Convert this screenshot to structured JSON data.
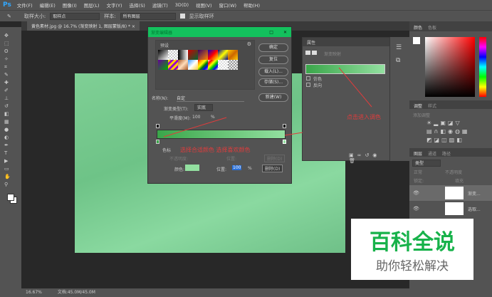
{
  "menubar": {
    "logo": "Ps",
    "items": [
      "文件(F)",
      "编辑(E)",
      "图像(I)",
      "图层(L)",
      "文字(Y)",
      "选择(S)",
      "滤镜(T)",
      "3D(D)",
      "视图(V)",
      "窗口(W)",
      "帮助(H)"
    ]
  },
  "options": {
    "sample_size_label": "取样大小:",
    "sample_size": "取样点",
    "sample_label": "样本:",
    "sample": "所有图层",
    "show_ring": "显示取样环"
  },
  "doc_tab": "黄色素材.jpg @ 16.7% (渐变映射 1, 图层蒙版/8) * ×",
  "dialog": {
    "title": "渐变编辑器",
    "presets_label": "预设",
    "ok": "确定",
    "reset": "复位",
    "load": "载入(L)...",
    "save": "存储(S)...",
    "name_label": "名称(N):",
    "name_value": "自定",
    "new": "新建(W)",
    "type_label": "渐变类型(T):",
    "type_value": "实底",
    "smooth_label": "平滑度(M):",
    "smooth_value": "100",
    "pct": "%",
    "stops_label": "色标",
    "opacity_label": "不透明度:",
    "location_label": "位置:",
    "delete": "删除(D)",
    "color_label": "颜色:",
    "location_value": "100",
    "annotation": "选择合适颜色  选择喜欢颜色",
    "gradient_start": "#3aa64a",
    "gradient_end": "#93e0a0"
  },
  "properties": {
    "title": "属性",
    "subtitle": "渐变映射",
    "dither": "仿色",
    "reverse": "反向",
    "annotation": "点击进入调色"
  },
  "right": {
    "color_tab": "颜色",
    "swatch_tab": "色板",
    "adjust_tab": "调整",
    "style_tab": "样式",
    "add_adjust": "添加调整",
    "layers_tab": "图层",
    "channels_tab": "通道",
    "paths_tab": "路径",
    "kind": "类型",
    "mode": "正常",
    "opacity": "不透明度",
    "lock": "锁定:",
    "fill": "填充",
    "layers": [
      "渐变...",
      "选取..."
    ]
  },
  "status": {
    "zoom": "16.67%",
    "doc": "文档:45.0M/45.0M"
  },
  "watermark": {
    "title": "百科全说",
    "subtitle": "助你轻松解决"
  }
}
